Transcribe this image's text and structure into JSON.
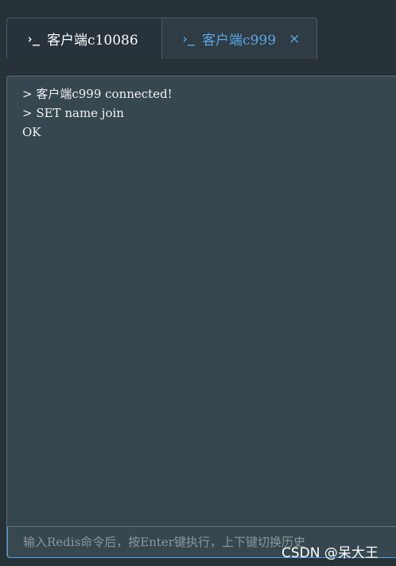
{
  "tabs": [
    {
      "icon": "terminal-icon",
      "prompt_glyph": "›_",
      "label": "客户端c10086",
      "active": false
    },
    {
      "icon": "terminal-icon",
      "prompt_glyph": "›_",
      "label": "客户端c999",
      "active": true,
      "close_glyph": "×"
    }
  ],
  "console": {
    "lines": [
      "> 客户端c999 connected!",
      "> SET name join",
      "OK"
    ],
    "input": {
      "value": "",
      "placeholder": "输入Redis命令后，按Enter键执行，上下键切换历史"
    }
  },
  "watermark": "CSDN @呆大王",
  "colors": {
    "background": "#263238",
    "console_bg": "#37474f",
    "active_tab_text": "#5aa8e8",
    "input_border": "#4d9fe6"
  }
}
